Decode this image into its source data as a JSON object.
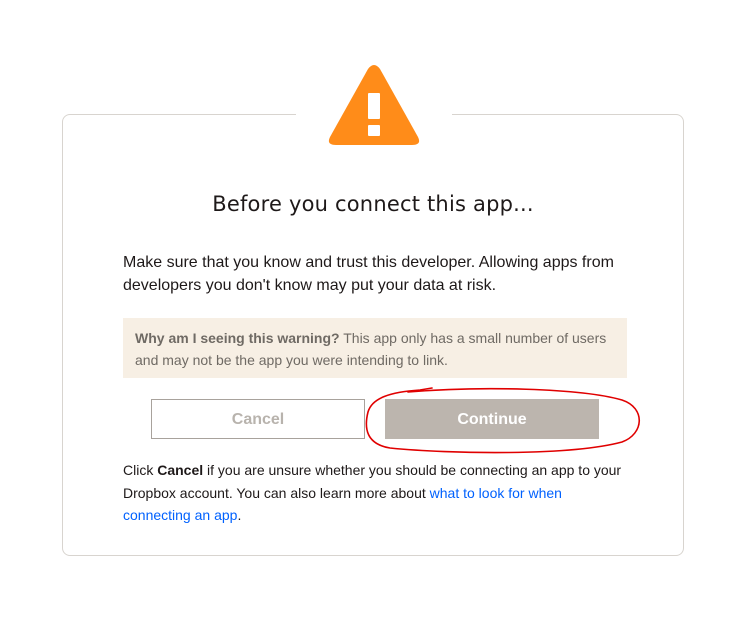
{
  "dialog": {
    "title": "Before you connect this app...",
    "body": "Make sure that you know and trust this developer. Allowing apps from developers you don't know may put your data at risk.",
    "notice": {
      "heading": "Why am I seeing this warning?",
      "text": " This app only has a small number of users and may not be the app you were intending to link."
    },
    "buttons": {
      "cancel": "Cancel",
      "continue": "Continue"
    },
    "footer": {
      "part1": "Click ",
      "cancel_word": "Cancel",
      "part2": " if you are unsure whether you should be connecting an app to your Dropbox account. You can also learn more about ",
      "link": "what to look for when connecting an app",
      "part3": "."
    }
  },
  "icon": "warning-triangle-icon",
  "colors": {
    "warning": "#ff8c19",
    "notice_bg": "#f7efe4",
    "continue_bg": "#bcb5ae",
    "link": "#0061fe",
    "annotation": "#e00000"
  }
}
